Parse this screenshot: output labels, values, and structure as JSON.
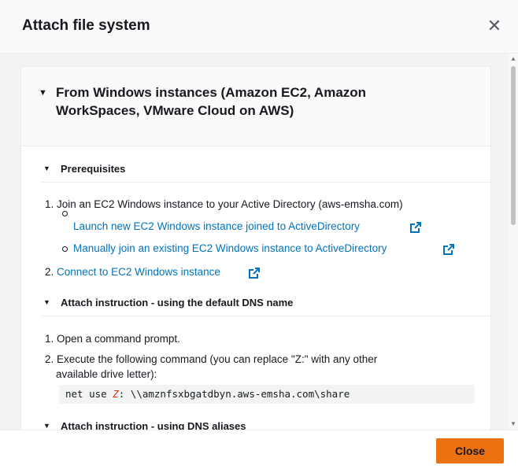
{
  "modal": {
    "title": "Attach file system",
    "close_icon": "close-icon"
  },
  "panel": {
    "title": "From Windows instances (Amazon EC2, Amazon WorkSpaces, VMware Cloud on AWS)",
    "title_line1": "From Windows instances (Amazon EC2, Amazon",
    "title_line2": "WorkSpaces, VMware Cloud on AWS)"
  },
  "prerequisites": {
    "title": "Prerequisites",
    "step1": "1. Join an EC2 Windows instance to your Active Directory (aws-emsha.com)",
    "link1": "Launch new EC2 Windows instance joined to ActiveDirectory",
    "link2": "Manually join an existing EC2 Windows instance to ActiveDirectory",
    "step2_prefix": "2.",
    "step2_link": "Connect to EC2 Windows instance"
  },
  "default_dns": {
    "title": "Attach instruction - using the default DNS name",
    "step1": "1. Open a command prompt.",
    "step2_line1": "2. Execute the following command (you can replace \"Z:\" with any other",
    "step2_line2": "available drive letter):",
    "code_prefix": "net use ",
    "code_var": "Z",
    "code_suffix": ": \\\\amznfsxbgatdbyn.aws-emsha.com\\share"
  },
  "dns_aliases": {
    "title": "Attach instruction - using DNS aliases"
  },
  "footer": {
    "close_label": "Close"
  },
  "colors": {
    "link": "#0073bb",
    "primary_button": "#ec7211",
    "code_var": "#d13212"
  }
}
